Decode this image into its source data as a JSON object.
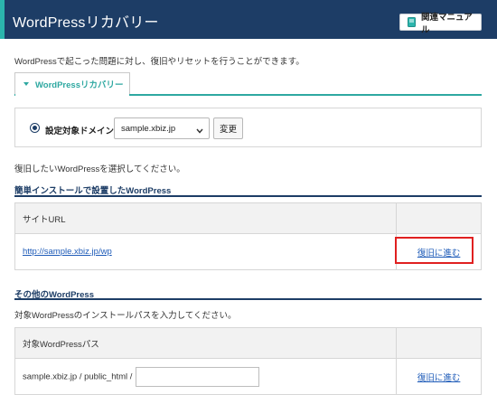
{
  "header": {
    "title": "WordPressリカバリー",
    "manual_button": "関連マニュアル",
    "manual_icon": "book-icon",
    "bg_color": "#1d3d66",
    "accent_color": "#2bb5ad"
  },
  "description": "WordPressで起こった問題に対し、復旧やリセットを行うことができます。",
  "tab": {
    "label": "WordPressリカバリー",
    "color": "#2ea8a1"
  },
  "domain": {
    "label": "設定対象ドメイン",
    "selected_value": "sample.xbiz.jp",
    "change_button": "変更"
  },
  "instruction": "復旧したいWordPressを選択してください。",
  "easy_install": {
    "section_title": "簡単インストールで設置したWordPress",
    "column_header": "サイトURL",
    "rows": [
      {
        "url": "http://sample.xbiz.jp/wp",
        "action": "復旧に進む"
      }
    ]
  },
  "other": {
    "section_title": "その他のWordPress",
    "instruction": "対象WordPressのインストールパスを入力してください。",
    "column_header": "対象WordPressパス",
    "path_prefix": "sample.xbiz.jp / public_html /",
    "path_value": "",
    "action": "復旧に進む"
  },
  "highlight_color": "#e02020"
}
